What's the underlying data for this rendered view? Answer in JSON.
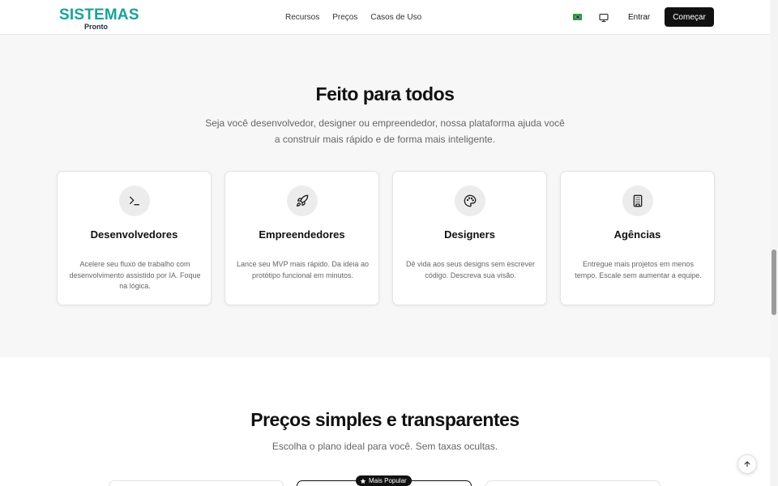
{
  "header": {
    "logo_main": "SISTEMAS",
    "logo_sub": "Pronto",
    "nav": [
      "Recursos",
      "Preços",
      "Casos de Uso"
    ],
    "entrar_label": "Entrar",
    "comecar_label": "Começar",
    "flag_icon": "brazil-flag-icon",
    "monitor_icon": "monitor-icon"
  },
  "audience": {
    "title": "Feito para todos",
    "subtitle": "Seja você desenvolvedor, designer ou empreendedor, nossa plataforma ajuda você a construir mais rápido e de forma mais inteligente.",
    "cards": [
      {
        "icon": "terminal-icon",
        "title": "Desenvolvedores",
        "desc": "Acelere seu fluxo de trabalho com desenvolvimento assistido por IA. Foque na lógica."
      },
      {
        "icon": "rocket-icon",
        "title": "Empreendedores",
        "desc": "Lance seu MVP mais rápido. Da ideia ao protótipo funcional em minutos."
      },
      {
        "icon": "palette-icon",
        "title": "Designers",
        "desc": "Dê vida aos seus designs sem escrever código. Descreva sua visão."
      },
      {
        "icon": "building-icon",
        "title": "Agências",
        "desc": "Entregue mais projetos em menos tempo. Escale sem aumentar a equipe."
      }
    ]
  },
  "pricing": {
    "title": "Preços simples e transparentes",
    "subtitle": "Escolha o plano ideal para você. Sem taxas ocultas.",
    "popular_badge": "Mais Popular"
  },
  "colors": {
    "brand": "#16a596",
    "dark": "#111111"
  }
}
